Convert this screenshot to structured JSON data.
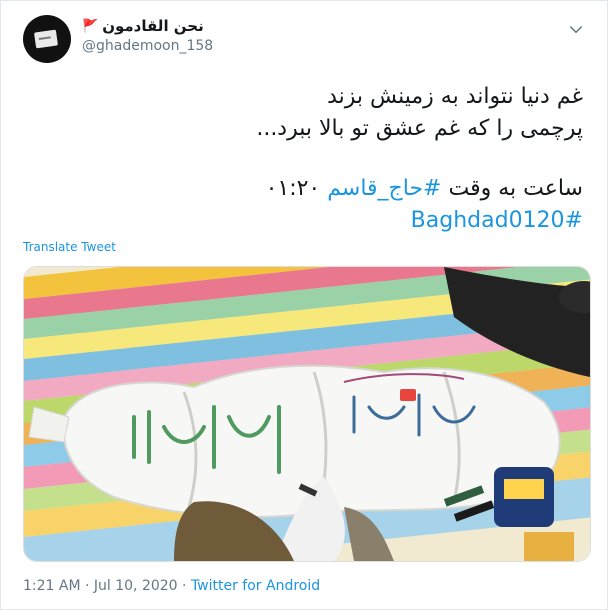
{
  "tweet": {
    "display_name": "نحن القادمون",
    "flag_glyph": "🚩",
    "handle": "@ghademoon_158",
    "lines": [
      "غم دنیا نتواند به زمینش بزند",
      "پرچمی را که غم عشق تو بالا ببرد..."
    ],
    "time_prefix": "ساعت به وقت ",
    "hashtag_1": "#حاج_قاسم",
    "time_value": " ۰۱:۲۰",
    "hashtag_2": "#Baghdad0120",
    "translate_label": "Translate Tweet",
    "timestamp": "1:21 AM · Jul 10, 2020 · ",
    "source": "Twitter for Android"
  },
  "colors": {
    "link": "#1b95e0",
    "secondary_text": "#657786"
  },
  "icons": {
    "avatar": "profile-avatar",
    "menu": "chevron-down-icon"
  }
}
